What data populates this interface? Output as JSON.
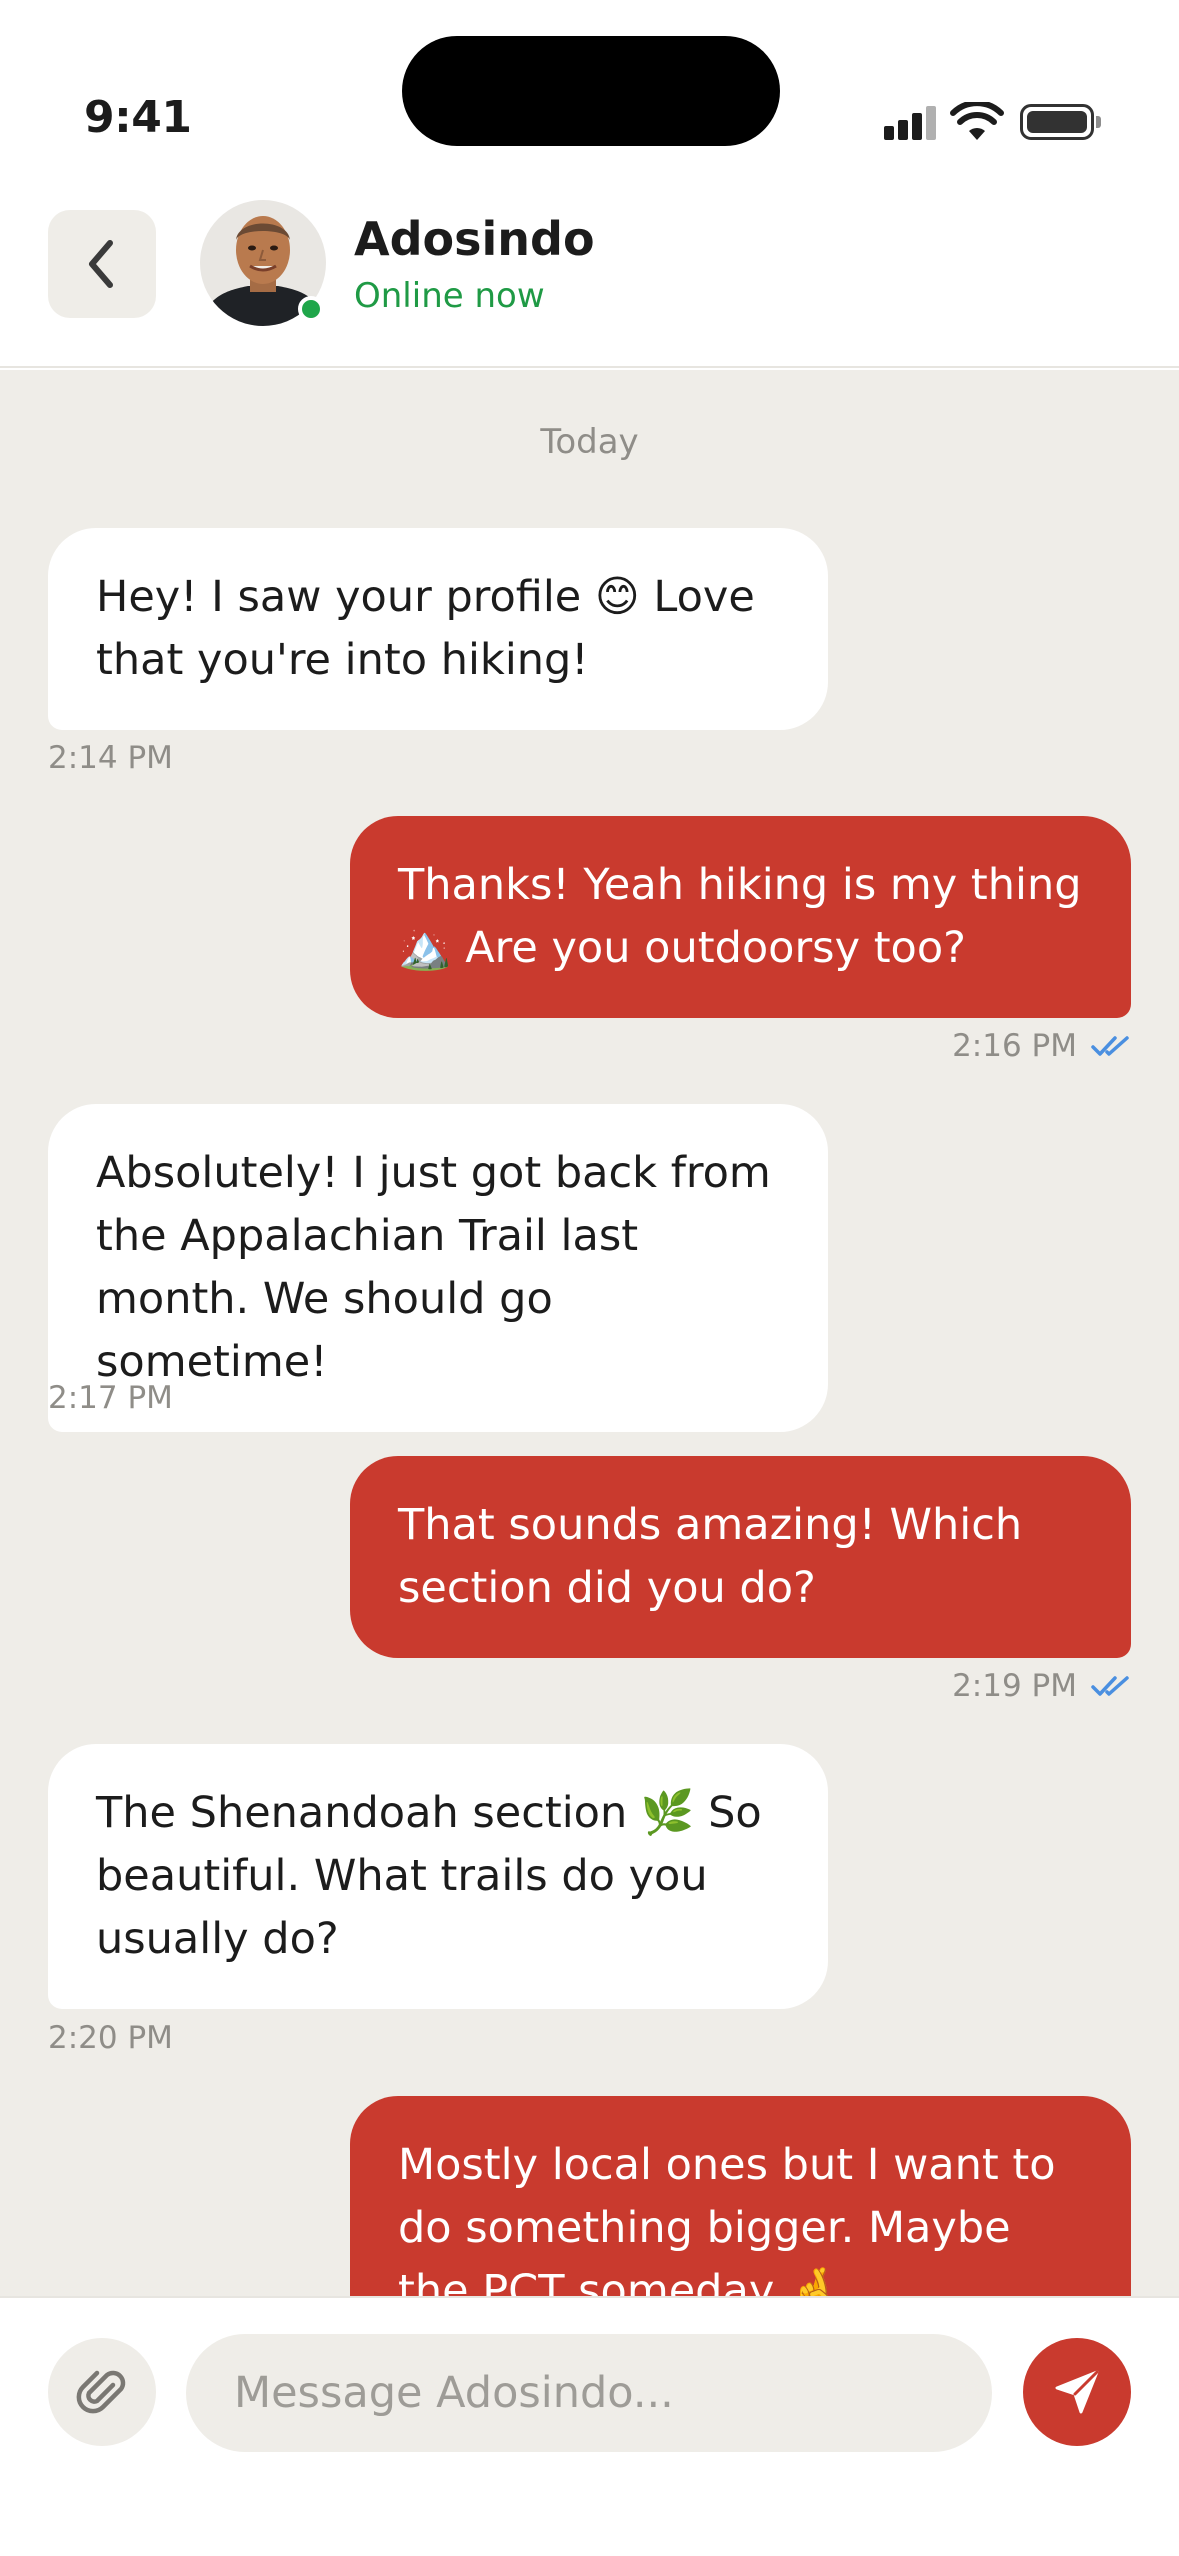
{
  "status_bar": {
    "time": "9:41"
  },
  "header": {
    "contact_name": "Adosindo",
    "status": "Online now",
    "online": true
  },
  "chat": {
    "day_label": "Today",
    "messages": [
      {
        "direction": "incoming",
        "text": "Hey! I saw your profile 😊  Love that you're into hiking!",
        "time": "2:14 PM"
      },
      {
        "direction": "outgoing",
        "text": "Thanks! Yeah hiking is my thing 🏔️  Are you outdoorsy too?",
        "time": "2:16 PM",
        "read": true
      },
      {
        "direction": "incoming",
        "text": "Absolutely! I just got back from the Appalachian Trail last month. We should go sometime!",
        "time": "2:17 PM"
      },
      {
        "direction": "outgoing",
        "text": "That sounds amazing! Which section did you do?",
        "time": "2:19 PM",
        "read": true
      },
      {
        "direction": "incoming",
        "text": "The Shenandoah section 🌿  So beautiful. What trails do you usually do?",
        "time": "2:20 PM"
      },
      {
        "direction": "outgoing",
        "text": "Mostly local ones but I want to do something bigger. Maybe the PCT someday 🤞"
      }
    ]
  },
  "composer": {
    "placeholder": "Message Adosindo..."
  },
  "colors": {
    "accent": "#c93a2e",
    "online_green": "#1fa64a",
    "chat_background": "#efede8",
    "read_ticks": "#4a8fe0"
  },
  "icons": {
    "back": "chevron-left-icon",
    "attach": "paperclip-icon",
    "send": "send-icon",
    "read_receipt": "double-check-icon"
  }
}
